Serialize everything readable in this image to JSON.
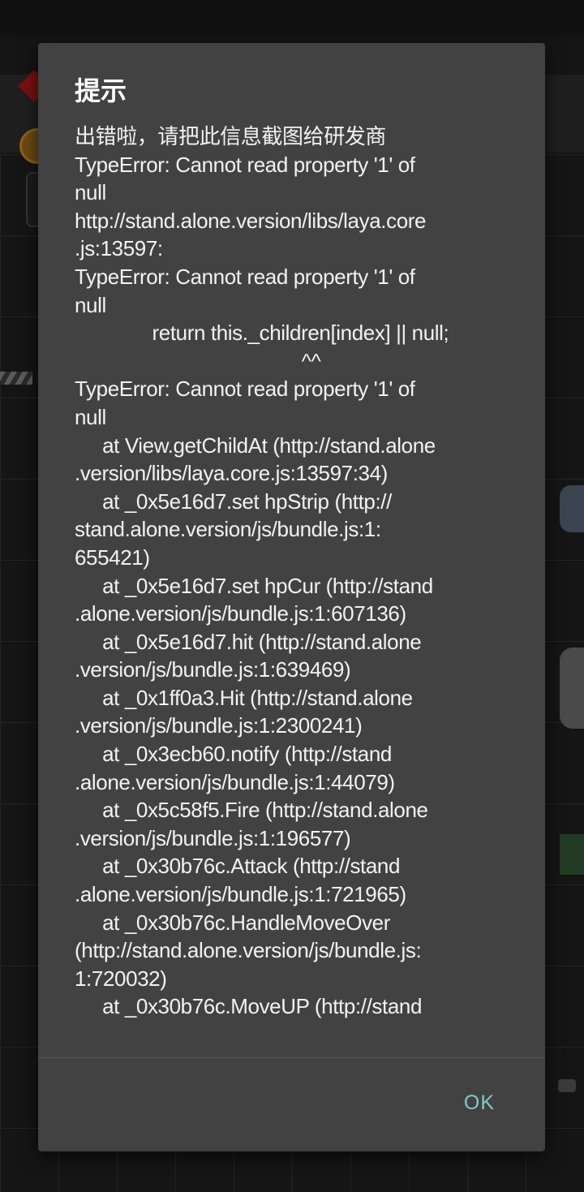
{
  "dialog": {
    "title": "提示",
    "lines": [
      "出错啦，请把此信息截图给研发商",
      "TypeError: Cannot read property '1' of",
      "null",
      "http://stand.alone.version/libs/laya.core",
      ".js:13597:",
      "TypeError: Cannot read property '1' of",
      "null",
      "              return this._children[index] || null;",
      "                                         ^^",
      "TypeError: Cannot read property '1' of",
      "null",
      "     at View.getChildAt (http://stand.alone",
      ".version/libs/laya.core.js:13597:34)",
      "     at _0x5e16d7.set hpStrip (http://",
      "stand.alone.version/js/bundle.js:1:",
      "655421)",
      "     at _0x5e16d7.set hpCur (http://stand",
      ".alone.version/js/bundle.js:1:607136)",
      "     at _0x5e16d7.hit (http://stand.alone",
      ".version/js/bundle.js:1:639469)",
      "     at _0x1ff0a3.Hit (http://stand.alone",
      ".version/js/bundle.js:1:2300241)",
      "     at _0x3ecb60.notify (http://stand",
      ".alone.version/js/bundle.js:1:44079)",
      "     at _0x5c58f5.Fire (http://stand.alone",
      ".version/js/bundle.js:1:196577)",
      "     at _0x30b76c.Attack (http://stand",
      ".alone.version/js/bundle.js:1:721965)",
      "     at _0x30b76c.HandleMoveOver",
      "(http://stand.alone.version/js/bundle.js:",
      "1:720032)",
      "     at _0x30b76c.MoveUP (http://stand"
    ],
    "ok_label": "OK"
  },
  "colors": {
    "dialog_background": "#424242",
    "accent": "#80cbc4",
    "text": "#f2f2f2"
  }
}
